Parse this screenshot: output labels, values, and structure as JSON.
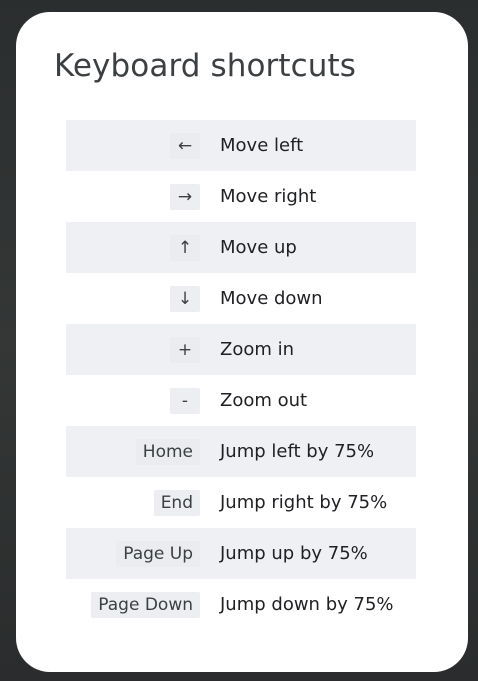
{
  "dialog": {
    "title": "Keyboard shortcuts"
  },
  "shortcuts": [
    {
      "key": "←",
      "description": "Move left"
    },
    {
      "key": "→",
      "description": "Move right"
    },
    {
      "key": "↑",
      "description": "Move up"
    },
    {
      "key": "↓",
      "description": "Move down"
    },
    {
      "key": "+",
      "description": "Zoom in"
    },
    {
      "key": "-",
      "description": "Zoom out"
    },
    {
      "key": "Home",
      "description": "Jump left by 75%"
    },
    {
      "key": "End",
      "description": "Jump right by 75%"
    },
    {
      "key": "Page Up",
      "description": "Jump up by 75%"
    },
    {
      "key": "Page Down",
      "description": "Jump down by 75%"
    }
  ],
  "colors": {
    "dialog_background": "#ffffff",
    "row_shade": "#eef0f4",
    "title_text": "#3c4043"
  }
}
